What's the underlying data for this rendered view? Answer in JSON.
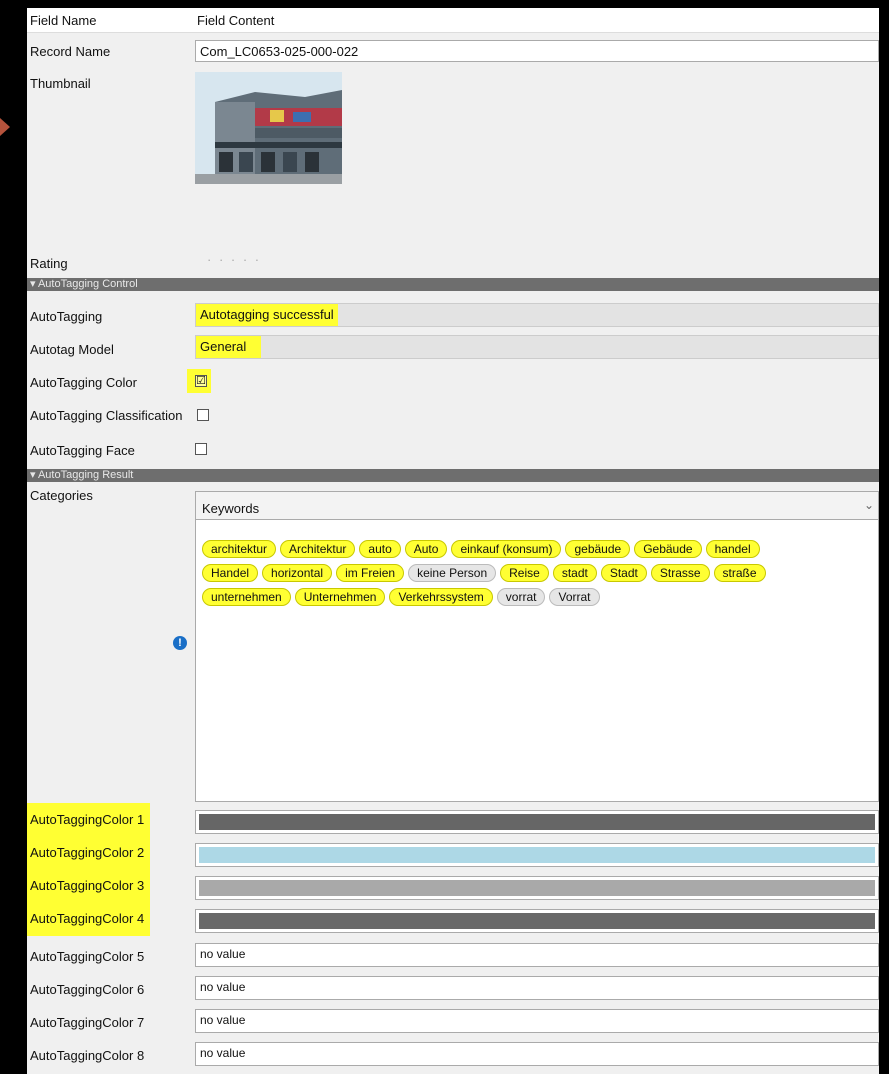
{
  "header": {
    "field_name": "Field Name",
    "field_content": "Field Content"
  },
  "record_name": {
    "label": "Record Name",
    "value": "Com_LC0653-025-000-022"
  },
  "thumbnail": {
    "label": "Thumbnail"
  },
  "rating": {
    "label": "Rating",
    "value": "· · · · ·"
  },
  "autotagging_control": {
    "section_title": "▾ AutoTagging Control",
    "autotagging": {
      "label": "AutoTagging",
      "value": "Autotagging successful"
    },
    "autotag_model": {
      "label": "Autotag Model",
      "value": "General"
    },
    "color": {
      "label": "AutoTagging Color",
      "checked": true,
      "mark": "☑"
    },
    "classification": {
      "label": "AutoTagging Classification",
      "checked": false
    },
    "face": {
      "label": "AutoTagging Face",
      "checked": false
    }
  },
  "autotagging_result": {
    "section_title": "▾ AutoTagging Result",
    "categories": {
      "label": "Categories",
      "dropdown_value": "Keywords",
      "dropdown_icon": "chevron-down-icon"
    },
    "tag_rows": [
      [
        "architektur",
        "Architektur",
        "auto",
        "Auto",
        "einkauf (konsum)",
        "gebäude",
        "Gebäude",
        "handel"
      ],
      [
        "Handel",
        "horizontal",
        "im Freien",
        "keine Person",
        "Reise",
        "stadt",
        "Stadt",
        "Strasse",
        "straße"
      ],
      [
        "unternehmen",
        "Unternehmen",
        "Verkehrssystem",
        "vorrat",
        "Vorrat"
      ]
    ],
    "highlighted_tags": [
      "architektur",
      "Architektur",
      "auto",
      "Auto",
      "einkauf (konsum)",
      "gebäude",
      "Gebäude",
      "handel",
      "Handel",
      "horizontal",
      "im Freien",
      "Reise",
      "stadt",
      "Stadt",
      "Strasse",
      "straße",
      "unternehmen",
      "Unternehmen",
      "Verkehrssystem"
    ],
    "info_icon": "info-icon"
  },
  "colors": [
    {
      "label": "AutoTaggingColor 1",
      "color": "#666666"
    },
    {
      "label": "AutoTaggingColor 2",
      "color": "#add8e6"
    },
    {
      "label": "AutoTaggingColor 3",
      "color": "#a9a9a9"
    },
    {
      "label": "AutoTaggingColor 4",
      "color": "#696969"
    }
  ],
  "empty_colors": [
    {
      "label": "AutoTaggingColor 5",
      "value": "no value"
    },
    {
      "label": "AutoTaggingColor 6",
      "value": "no value"
    },
    {
      "label": "AutoTaggingColor 7",
      "value": "no value"
    },
    {
      "label": "AutoTaggingColor 8",
      "value": "no value"
    }
  ]
}
